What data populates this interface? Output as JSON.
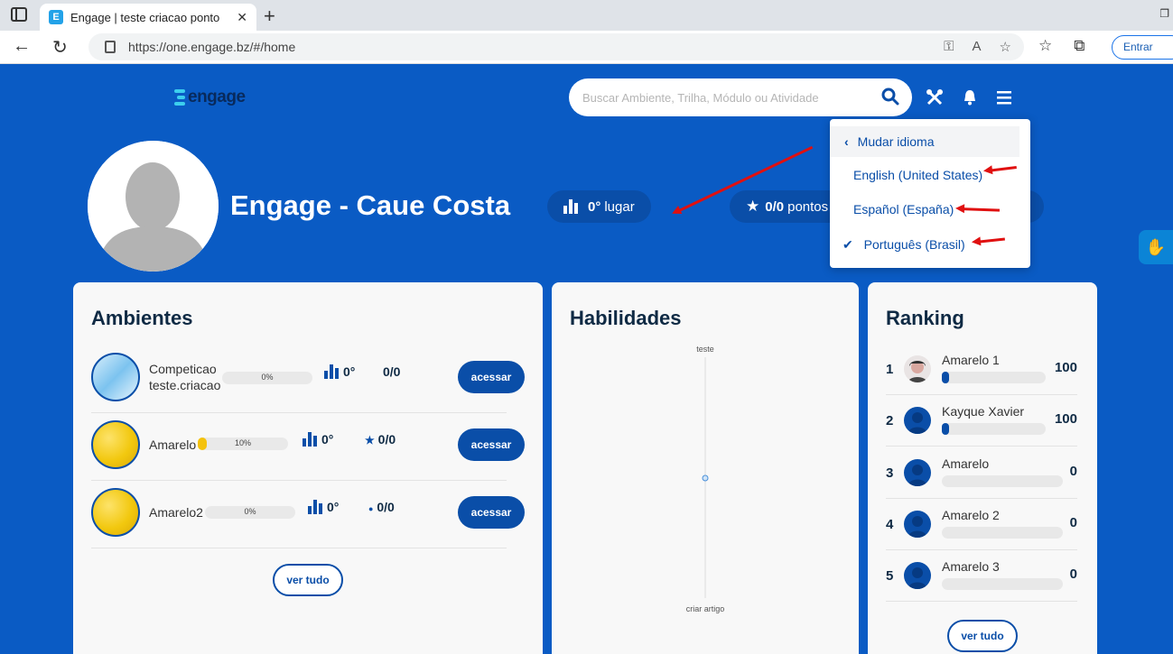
{
  "browser": {
    "tab_title": "Engage | teste criacao ponto",
    "url": "https://one.engage.bz/#/home",
    "signin_label": "Entrar"
  },
  "header": {
    "logo_text": "engage",
    "search_placeholder": "Buscar Ambiente, Trilha, Módulo ou Atividade"
  },
  "profile": {
    "name": "Engage - Caue Costa",
    "rank_value": "0°",
    "rank_label": "lugar",
    "points_value": "0/0",
    "points_label": "pontos"
  },
  "language_menu": {
    "back_label": "Mudar idioma",
    "options": [
      {
        "label": "English (United States)",
        "selected": false
      },
      {
        "label": "Español (España)",
        "selected": false
      },
      {
        "label": "Português (Brasil)",
        "selected": true
      }
    ]
  },
  "ambientes": {
    "title": "Ambientes",
    "items": [
      {
        "name_line1": "Competicao",
        "name_line2": "teste.criacao",
        "progress_label": "0%",
        "progress": 0,
        "rank": "0°",
        "points": "0/0",
        "button": "acessar"
      },
      {
        "name_line1": "Amarelo",
        "progress_label": "10%",
        "progress": 0.1,
        "rank": "0°",
        "points": "0/0",
        "button": "acessar"
      },
      {
        "name_line1": "Amarelo2",
        "progress_label": "0%",
        "progress": 0,
        "rank": "0°",
        "points": "0/0",
        "button": "acessar"
      }
    ],
    "see_all": "ver tudo"
  },
  "habilidades": {
    "title": "Habilidades",
    "chart_data": {
      "type": "radar",
      "axes": [
        "teste",
        "criar artigo"
      ],
      "values": [
        0,
        0
      ]
    }
  },
  "ranking": {
    "title": "Ranking",
    "items": [
      {
        "position": "1",
        "name": "Amarelo 1",
        "score": "100",
        "progress": 0.07
      },
      {
        "position": "2",
        "name": "Kayque Xavier",
        "score": "100",
        "progress": 0.07
      },
      {
        "position": "3",
        "name": "Amarelo",
        "score": "0",
        "progress": 0
      },
      {
        "position": "4",
        "name": "Amarelo 2",
        "score": "0",
        "progress": 0
      },
      {
        "position": "5",
        "name": "Amarelo 3",
        "score": "0",
        "progress": 0
      }
    ],
    "see_all": "ver tudo"
  },
  "colors": {
    "primary_blue": "#0a5bc4",
    "dark_blue": "#0a4ea8",
    "annotation_red": "#e01010",
    "progress_yellow": "#f4c20d"
  }
}
